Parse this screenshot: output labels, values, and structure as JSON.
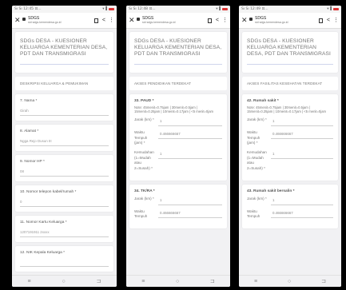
{
  "phones": [
    {
      "status": {
        "time": "12:45",
        "left": "Sı Sı 12:45 ⊡..."
      },
      "browser": {
        "title": "SDGS",
        "url": "sid sdgs.kemendesa.go.id"
      },
      "form_title": "SDGs DESA - KUESIONER KELUARGA KEMENTERIAN DESA, PDT DAN TRANSMIGRASI",
      "section": "DESKRIPSI KELUARGA & PEMUKIMAN",
      "fields": [
        {
          "label": "7. Nama *",
          "value": "Girah"
        },
        {
          "label": "8. Alamat *",
          "value": "Ngga Rejo Dusun III"
        },
        {
          "label": "9. Nomor HP *",
          "value": "08"
        },
        {
          "label": "10. Nomor telepon kabel/rumah *",
          "value": "0"
        },
        {
          "label": "11. Nomor Kartu Keluarga *",
          "value": "1207191911 2xxxx"
        },
        {
          "label": "12. NIK Kepala Keluarga *",
          "value": ""
        }
      ]
    },
    {
      "status": {
        "time": "12:48",
        "left": "Sı Sı 12:48 ⊡..."
      },
      "browser": {
        "title": "SDGS",
        "url": "sid sdgs.kemendesa.go.id"
      },
      "form_title": "SDGs DESA - KUESIONER KELUARGA KEMENTERIAN DESA, PDT DAN TRANSMIGRASI",
      "section": "AKSES PENDIDIKAN TERDEKAT",
      "questions": [
        {
          "label": "33. PAUD *",
          "note": "Note: 45menit=0.75jam | 30menit=0.5jam | 15menit=0.25jam | 10menit=0.17jam | <5 menit=0jam",
          "rows": [
            {
              "label": "Jarak (km) *",
              "value": "1"
            },
            {
              "label": "Waktu Tempuh (jam) *",
              "value": "0.466666667"
            },
            {
              "label": "Kemudahan (1=Mudah atau 2=Susah) *",
              "value": "1"
            }
          ]
        },
        {
          "label": "34. TK/RA *",
          "note": "",
          "rows": [
            {
              "label": "Jarak (km) *",
              "value": "1"
            },
            {
              "label": "Waktu Tempuh",
              "value": "0.466666667"
            }
          ]
        }
      ]
    },
    {
      "status": {
        "time": "12:49",
        "left": "Sı Sı 12:49 ⊡..."
      },
      "browser": {
        "title": "SDGS",
        "url": "sid sdgs.kemendesa.go.id"
      },
      "form_title": "SDGs DESA - KUESIONER KELUARGA KEMENTERIAN DESA, PDT DAN TRANSMIGRASI",
      "section": "AKSES FASILITAS KESEHATAN TERDEKAT",
      "questions": [
        {
          "label": "42. Rumah sakit *",
          "note": "Note: 45menit=0.75jam | 30menit=0.5jam | 15menit=0.25jam | 10menit=0.17jam | <5 menit=0jam",
          "rows": [
            {
              "label": "Jarak (km) *",
              "value": "1"
            },
            {
              "label": "Waktu Tempuh (jam) *",
              "value": "0.466666667"
            },
            {
              "label": "Kemudahan (1=Mudah atau 2=Susah) *",
              "value": "1"
            }
          ]
        },
        {
          "label": "43. Rumah sakit bersalin *",
          "note": "",
          "rows": [
            {
              "label": "Jarak (km) *",
              "value": "1"
            },
            {
              "label": "Waktu Tempuh",
              "value": "0.466666667"
            }
          ]
        }
      ]
    }
  ],
  "nav": {
    "menu_icon": "≡",
    "home_icon": "○",
    "back_icon": "⊐"
  }
}
